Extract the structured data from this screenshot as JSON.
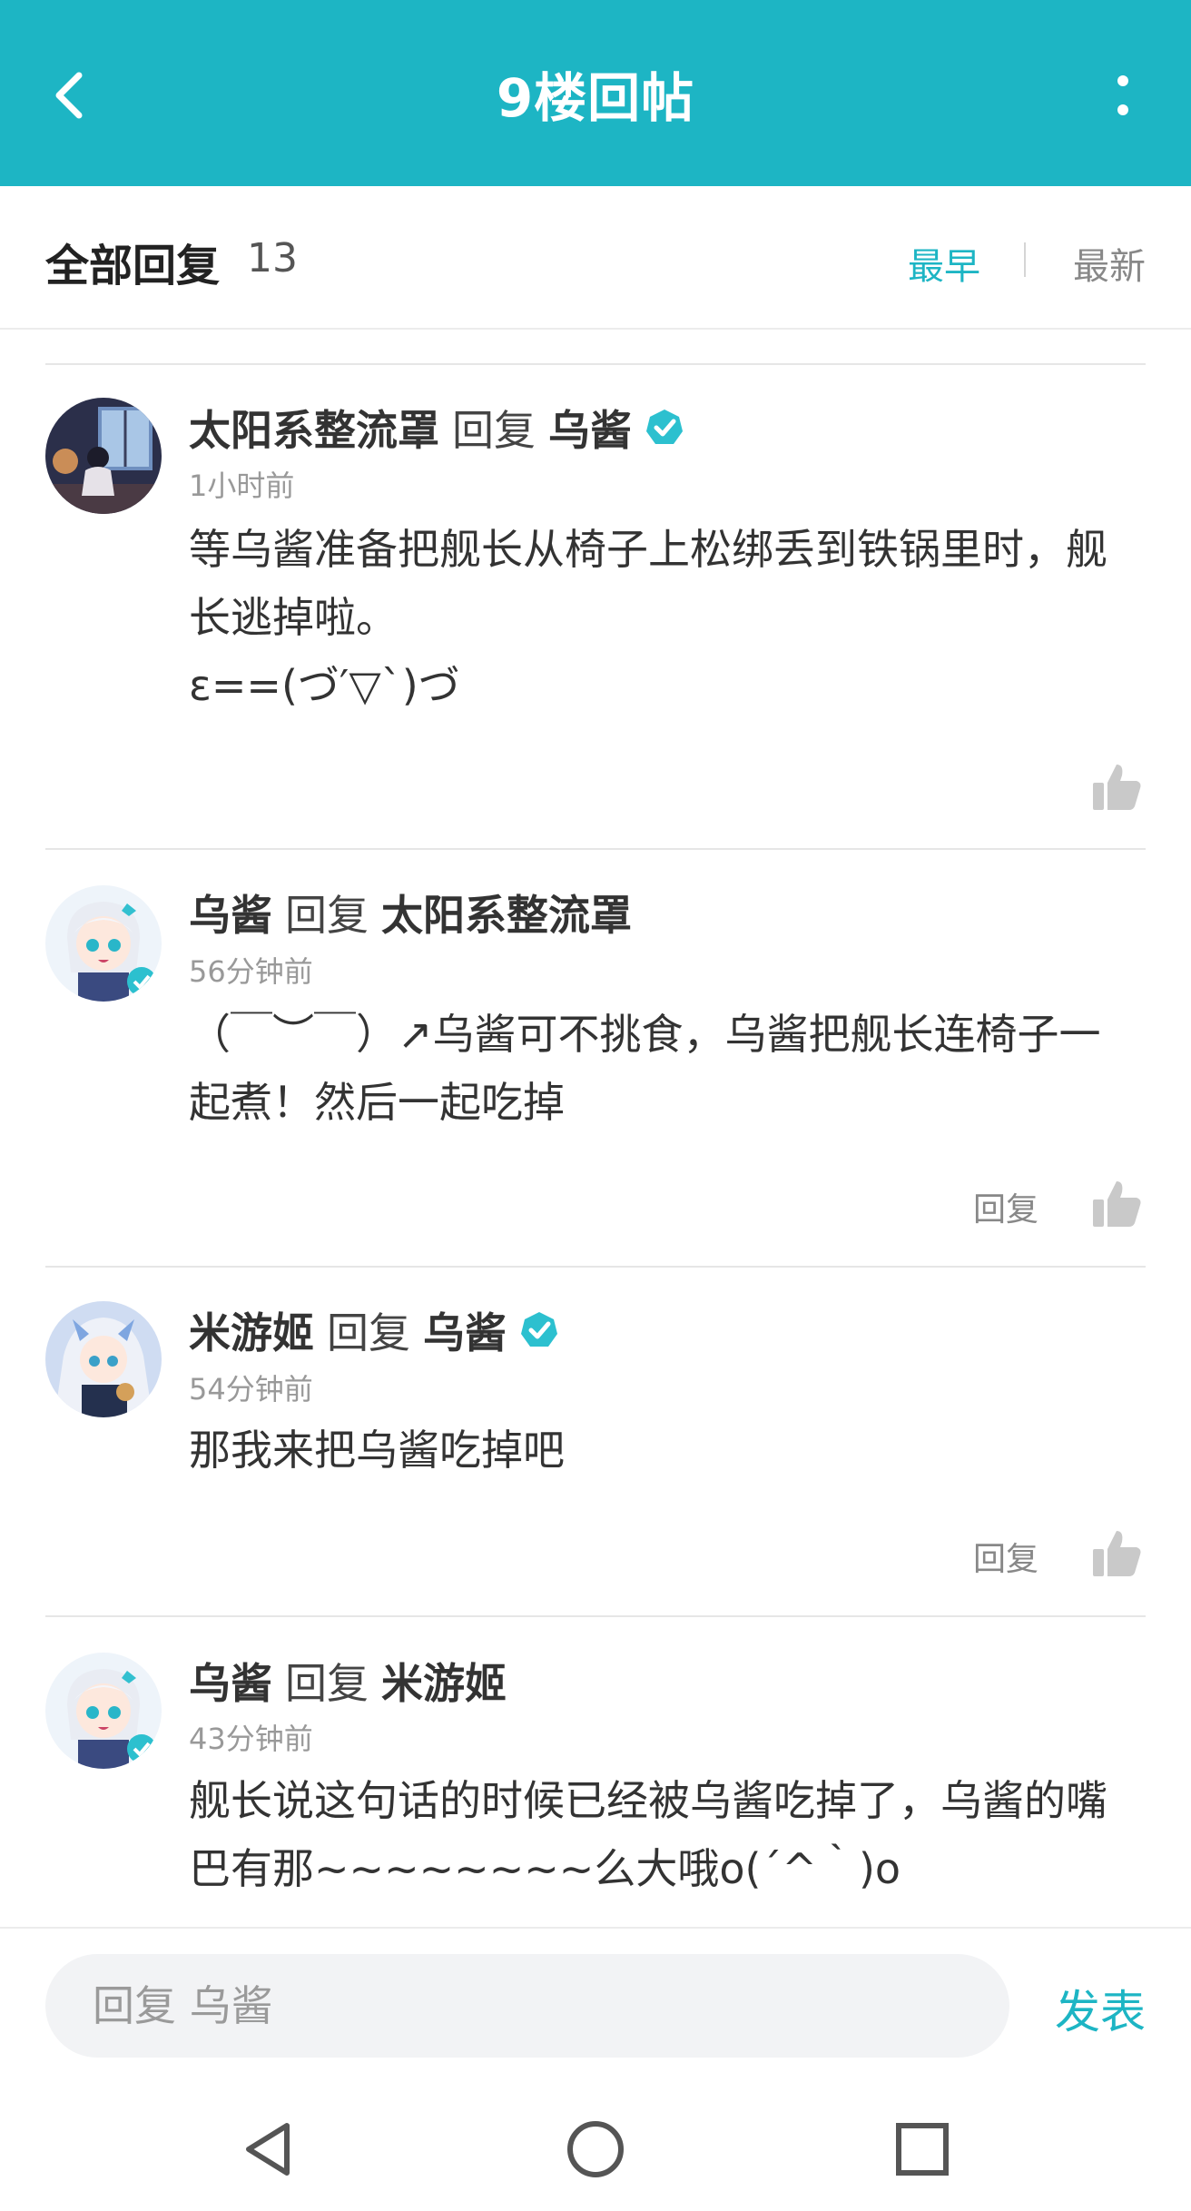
{
  "header": {
    "title": "9楼回帖"
  },
  "reply_bar": {
    "label": "全部回复",
    "count": "13",
    "sort_earliest": "最早",
    "sort_latest": "最新"
  },
  "comments": [
    {
      "user": "太阳系整流罩",
      "reply_word": "回复",
      "target": "乌酱",
      "target_verified": true,
      "time": "1小时前",
      "lines": [
        "等乌酱准备把舰长从椅子上松绑丢到铁锅里时，舰",
        "长逃掉啦。",
        "ε==(づ′▽`)づ"
      ],
      "reply_label": ""
    },
    {
      "user": "乌酱",
      "reply_word": "回复",
      "target": "太阳系整流罩",
      "target_verified": false,
      "time": "56分钟前",
      "lines": [
        "（￣︶￣）↗乌酱可不挑食，乌酱把舰长连椅子一",
        "起煮！然后一起吃掉"
      ],
      "reply_label": "回复"
    },
    {
      "user": "米游姬",
      "reply_word": "回复",
      "target": "乌酱",
      "target_verified": true,
      "time": "54分钟前",
      "lines": [
        "那我来把乌酱吃掉吧"
      ],
      "reply_label": "回复"
    },
    {
      "user": "乌酱",
      "reply_word": "回复",
      "target": "米游姬",
      "target_verified": false,
      "time": "43分钟前",
      "lines": [
        "舰长说这句话的时候已经被乌酱吃掉了，乌酱的嘴",
        "巴有那~~~~~~~~么大哦o(´^｀)o"
      ],
      "reply_label": ""
    }
  ],
  "input": {
    "placeholder": "回复 乌酱",
    "send_label": "发表"
  },
  "colors": {
    "accent": "#1db5c4",
    "verified": "#2cc0cf"
  },
  "icons": [
    "back-arrow-icon",
    "more-vertical-icon",
    "verified-icon",
    "thumb-up-icon",
    "nav-back-icon",
    "nav-home-icon",
    "nav-recents-icon"
  ]
}
